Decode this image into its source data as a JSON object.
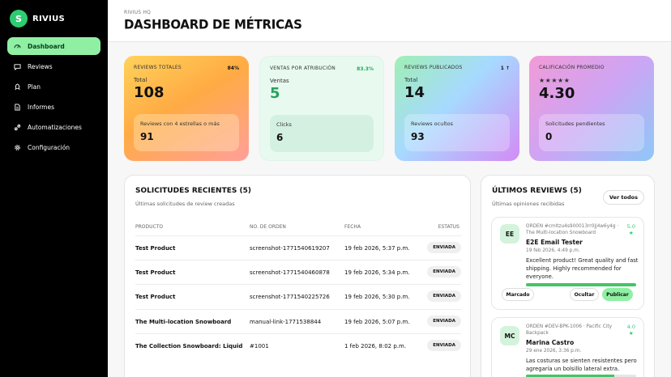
{
  "brand": {
    "logo_letter": "S",
    "name": "RIVIUS"
  },
  "sidebar": {
    "items": [
      {
        "label": "Dashboard",
        "icon": "gauge-icon"
      },
      {
        "label": "Reviews",
        "icon": "chat-bubble-icon"
      },
      {
        "label": "Plan",
        "icon": "rocket-icon"
      },
      {
        "label": "Informes",
        "icon": "document-icon"
      },
      {
        "label": "Automatizaciones",
        "icon": "link-icon"
      },
      {
        "label": "Configuración",
        "icon": "gear-icon"
      }
    ]
  },
  "header": {
    "breadcrumb": "RIVIUS HQ",
    "title": "DASHBOARD DE MÉTRICAS"
  },
  "kpis": [
    {
      "label": "REVIEWS TOTALES",
      "badge": "84%",
      "sub": "Total",
      "value": "108",
      "inner_label": "Reviews con 4 estrellas o más",
      "inner_value": "91"
    },
    {
      "label": "VENTAS POR ATRIBUCIÓN",
      "badge": "83.3%",
      "sub": "Ventas",
      "value": "5",
      "inner_label": "Clicks",
      "inner_value": "6"
    },
    {
      "label": "REVIEWS PUBLICADOS",
      "badge": "1 ↑",
      "sub": "Total",
      "value": "14",
      "inner_label": "Reviews ocultos",
      "inner_value": "93"
    },
    {
      "label": "CALIFICACIÓN PROMEDIO",
      "stars": "★★★★★",
      "value": "4.30",
      "inner_label": "Solicitudes pendientes",
      "inner_value": "0"
    }
  ],
  "requests": {
    "title": "SOLICITUDES RECIENTES (5)",
    "subtitle": "Últimas solicitudes de review creadas",
    "columns": [
      "PRODUCTO",
      "NO. DE ORDEN",
      "FECHA",
      "ESTATUS"
    ],
    "rows": [
      {
        "product": "Test Product",
        "order": "screenshot-1771540619207",
        "date": "19 feb 2026, 5:37 p.m.",
        "status": "ENVIADA"
      },
      {
        "product": "Test Product",
        "order": "screenshot-1771540460878",
        "date": "19 feb 2026, 5:34 p.m.",
        "status": "ENVIADA"
      },
      {
        "product": "Test Product",
        "order": "screenshot-1771540225726",
        "date": "19 feb 2026, 5:30 p.m.",
        "status": "ENVIADA"
      },
      {
        "product": "The Multi-location Snowboard",
        "order": "manual-link-1771538844",
        "date": "19 feb 2026, 5:07 p.m.",
        "status": "ENVIADA"
      },
      {
        "product": "The Collection Snowboard: Liquid",
        "order": "#1001",
        "date": "1 feb 2026, 8:02 p.m.",
        "status": "ENVIADA"
      }
    ]
  },
  "reviews": {
    "title": "ÚLTIMOS REVIEWS (5)",
    "subtitle": "Últimas opiniones recibidas",
    "see_all": "Ver todos",
    "items": [
      {
        "initials": "EE",
        "order": "ORDEN #cmltzu4s900013rr0jj4w6y4g · The Multi-location Snowboard",
        "score": "5.0",
        "star": "★",
        "name": "E2E Email Tester",
        "date": "19 feb 2026, 4:49 p.m.",
        "text": "Excellent product! Great quality and fast shipping. Highly recommended for everyone.",
        "progress": 1.0,
        "actions": [
          "Marcado",
          "Ocultar",
          "Publicar"
        ]
      },
      {
        "initials": "MC",
        "order": "ORDEN #DEV-BPK-1006 · Pacific City Backpack",
        "score": "4.0",
        "star": "★",
        "name": "Marina Castro",
        "date": "29 ene 2026, 3:36 p.m.",
        "text": "Las costuras se sienten resistentes pero agregaría un bolsillo lateral extra.",
        "progress": 0.8
      }
    ]
  },
  "colors": {
    "accent": "#8ff0a4",
    "green": "#2ecc71",
    "sidebar": "#000000"
  }
}
